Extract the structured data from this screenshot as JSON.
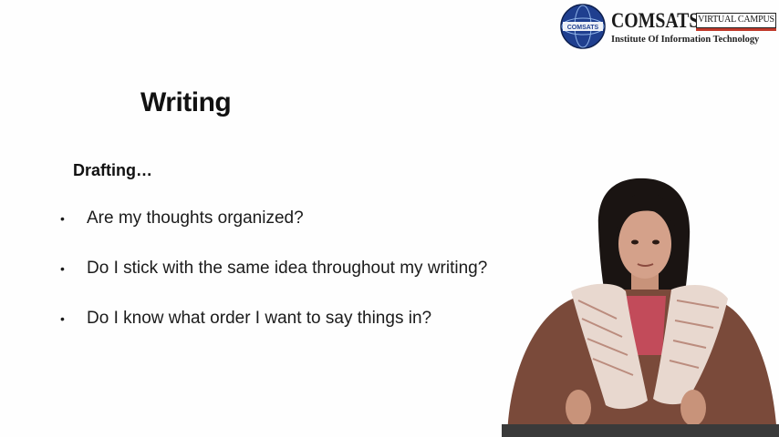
{
  "logo": {
    "brand": "COMSATS",
    "badge": "VIRTUAL CAMPUS",
    "subtitle": "Institute Of Information Technology",
    "emblem_text": "COMSATS"
  },
  "slide": {
    "title": "Writing",
    "subheading": "Drafting…",
    "bullets": [
      "Are my thoughts organized?",
      "Do I stick with the same idea throughout my writing?",
      "Do I know what order I want to  say things in?"
    ]
  },
  "colors": {
    "emblem_blue": "#1f3f8f",
    "badge_bar": "#c0392b",
    "text": "#111111"
  }
}
